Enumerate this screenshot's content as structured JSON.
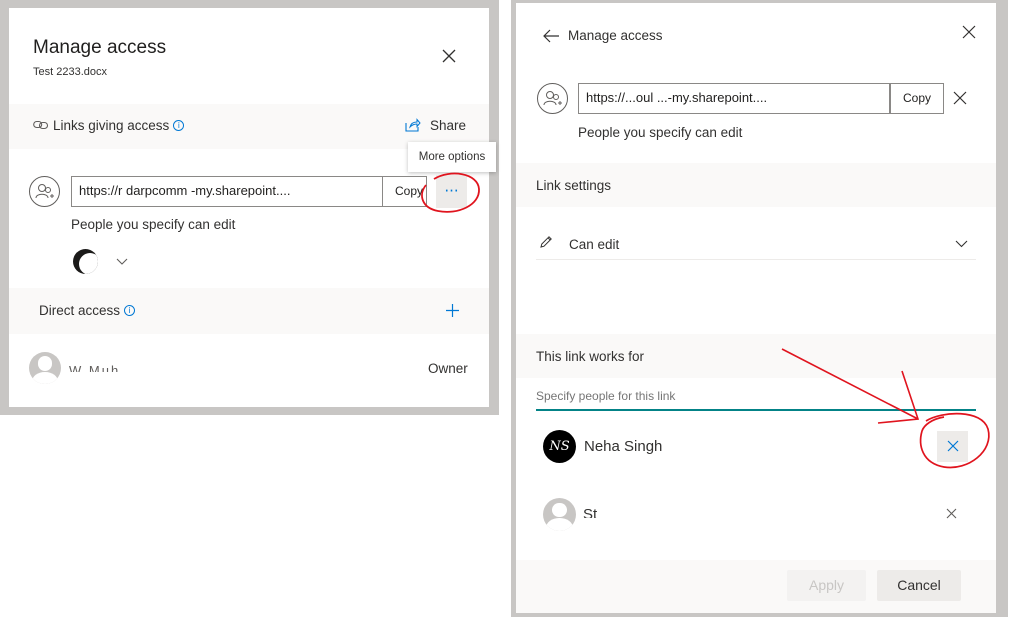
{
  "left_dialog": {
    "title": "Manage access",
    "file_name": "Test 2233.docx",
    "close_icon": "close-icon",
    "links_section": {
      "label": "Links giving access",
      "share_label": "Share"
    },
    "tooltip": "More options",
    "link": {
      "url": "https://r        darpcomm                -my.sharepoint....",
      "copy_label": "Copy",
      "more_label": "···",
      "description": "People you specify can edit"
    },
    "direct_access": {
      "label": "Direct access"
    },
    "owner_row": {
      "name": "W    Muh     ",
      "role": "Owner"
    }
  },
  "right_dialog": {
    "back_label": "Manage access",
    "link": {
      "url": "https://...oul              ...-my.sharepoint....",
      "copy_label": "Copy",
      "description": "People you specify can edit"
    },
    "link_settings": {
      "label": "Link settings",
      "permission": "Can edit"
    },
    "works_for": {
      "label": "This link works for",
      "placeholder": "Specify people for this link"
    },
    "people": [
      {
        "initials": "NS",
        "name": "Neha Singh"
      },
      {
        "initials": "",
        "name": "St"
      }
    ],
    "apply_label": "Apply",
    "cancel_label": "Cancel"
  },
  "colors": {
    "accent": "#0078d4",
    "annotation_red": "#e0141e",
    "section_bg": "#faf9f8",
    "overlay": "#c8c6c4"
  }
}
